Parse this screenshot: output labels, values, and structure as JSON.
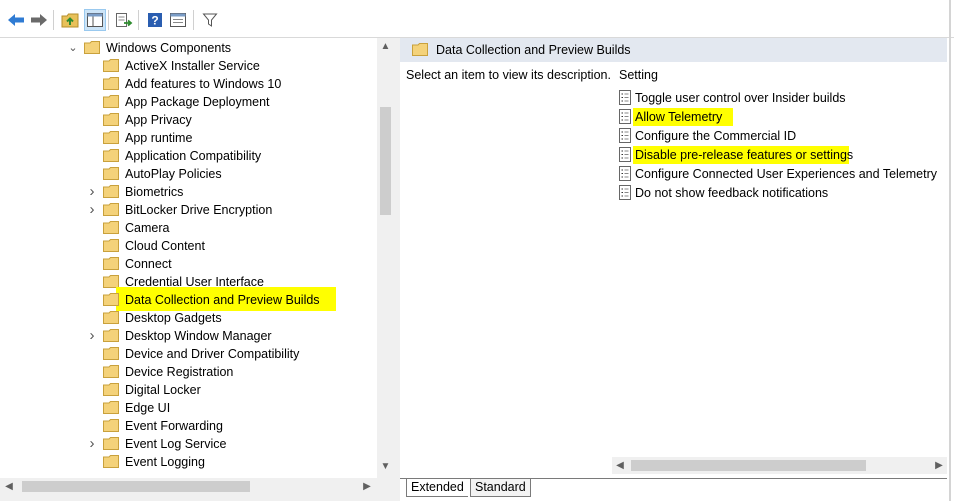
{
  "toolbar": {
    "buttons": [
      {
        "name": "back-arrow-icon"
      },
      {
        "name": "forward-arrow-icon"
      },
      {
        "name": "up-folder-icon"
      },
      {
        "name": "show-hide-tree-icon"
      },
      {
        "name": "export-list-icon"
      },
      {
        "name": "help-icon"
      },
      {
        "name": "properties-view-icon"
      },
      {
        "name": "filter-icon"
      }
    ]
  },
  "tree": {
    "parent": {
      "label": "Windows Components",
      "expanded": true
    },
    "items": [
      {
        "label": "ActiveX Installer Service",
        "expandable": false
      },
      {
        "label": "Add features to Windows 10",
        "expandable": false
      },
      {
        "label": "App Package Deployment",
        "expandable": false
      },
      {
        "label": "App Privacy",
        "expandable": false
      },
      {
        "label": "App runtime",
        "expandable": false
      },
      {
        "label": "Application Compatibility",
        "expandable": false
      },
      {
        "label": "AutoPlay Policies",
        "expandable": false
      },
      {
        "label": "Biometrics",
        "expandable": true
      },
      {
        "label": "BitLocker Drive Encryption",
        "expandable": true
      },
      {
        "label": "Camera",
        "expandable": false
      },
      {
        "label": "Cloud Content",
        "expandable": false
      },
      {
        "label": "Connect",
        "expandable": false
      },
      {
        "label": "Credential User Interface",
        "expandable": false
      },
      {
        "label": "Data Collection and Preview Builds",
        "expandable": false,
        "highlighted": true
      },
      {
        "label": "Desktop Gadgets",
        "expandable": false
      },
      {
        "label": "Desktop Window Manager",
        "expandable": true
      },
      {
        "label": "Device and Driver Compatibility",
        "expandable": false
      },
      {
        "label": "Device Registration",
        "expandable": false
      },
      {
        "label": "Digital Locker",
        "expandable": false
      },
      {
        "label": "Edge UI",
        "expandable": false
      },
      {
        "label": "Event Forwarding",
        "expandable": false
      },
      {
        "label": "Event Log Service",
        "expandable": true
      },
      {
        "label": "Event Logging",
        "expandable": false
      }
    ]
  },
  "right": {
    "header_title": "Data Collection and Preview Builds",
    "description": "Select an item to view its description.",
    "column_header": "Setting",
    "settings": [
      {
        "label": "Toggle user control over Insider builds",
        "highlighted": false
      },
      {
        "label": "Allow Telemetry",
        "highlighted": true
      },
      {
        "label": "Configure the Commercial ID",
        "highlighted": false
      },
      {
        "label": "Disable pre-release features or settings",
        "highlighted": true
      },
      {
        "label": "Configure Connected User Experiences and Telemetry",
        "highlighted": false
      },
      {
        "label": "Do not show feedback notifications",
        "highlighted": false
      }
    ]
  },
  "tabs": [
    {
      "label": "Extended",
      "active": true
    },
    {
      "label": "Standard",
      "active": false
    }
  ],
  "colors": {
    "highlight": "#ffff00",
    "folder": "#e8c15a",
    "header_bg": "#e3e8f0"
  }
}
